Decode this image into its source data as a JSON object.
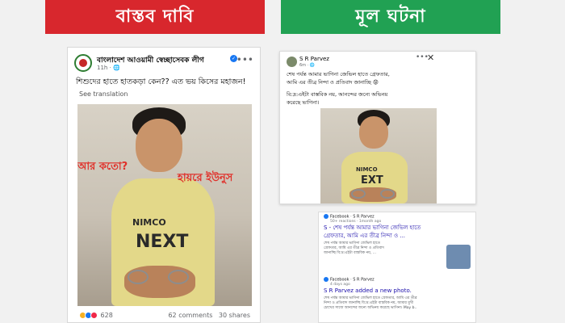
{
  "banners": {
    "left": "বাস্তব দাবি",
    "right": "মূল ঘটনা"
  },
  "left_post": {
    "page_name": "বাংলাদেশ আওয়ামী স্বেচ্ছাসেবক লীগ",
    "verified_icon": "✓",
    "time": "11h · 🌐",
    "more_icon": "•••",
    "text": "শিশুদের হাতে হাতকড়া কেন?? এত ভয় কিসের মহাজন!",
    "translate": "See translation",
    "overlay_1": "আর কতো?",
    "overlay_2": "হায়রে ইউনুস",
    "shirt_text": "NIMCO",
    "shirt_big": "NEXT",
    "reaction_count": "628",
    "comments": "62 comments",
    "shares": "30 shares",
    "colors": {
      "reactions": [
        "#f7b125",
        "#1877f2",
        "#f02849"
      ]
    }
  },
  "right_post": {
    "name": "S R Parvez",
    "time": "6m · 🌐",
    "more_icon": "•••",
    "close_icon": "✕",
    "line1": "শেষ পর্যন্ত আমার ভাগিনা জেভিল হাতে গ্রেফতার,",
    "line2": "আমি এর তীব্র নিন্দা ও প্রতিবাদ জানাচ্ছি 😡",
    "line3": "বি:দ্র:এইটা বাস্তবিক নয়, আনন্দের জন্যে অভিনয়",
    "line4": "করেছে ভাগিনা।",
    "shirt_text": "NIMCO",
    "shirt_big": "EXT"
  },
  "search_results": [
    {
      "source": "Facebook · S R Parvez",
      "sub": "50+ reactions · 1month ago",
      "title": "S - শেষ পর্যন্ত আমার ভাগিনা জেভিল হাতে",
      "title2": "গ্রেফতার, আমি এর তীব্র নিন্দা ও ...",
      "snippet1": "শেষ পর্যন্ত আমার ভাগিনা জেভিল হাতে",
      "snippet2": "গ্রেফতার, আমি এর তীব্র নিন্দা ও প্রতিবাদ",
      "snippet3": "জানাচ্ছি বি:দ্র:এইটা বাস্তবিক নয়, ..."
    },
    {
      "source": "Facebook · S R Parvez",
      "sub": "4 days ago",
      "title": "S R Parvez added a new photo.",
      "snippet1": "শেষ পর্যন্ত আমার ভাগিনা জেভিল হাতে গ্রেফতার, আমি এর তীব্র",
      "snippet2": "নিন্দা ও প্রতিবাদ জানাচ্ছি বি:দ্র:এইটা বাস্তবিক নয়, আমার মুখী",
      "snippet3": "চোখের সাজে আনন্দের জন্যে অভিনয় করেছে ভাগিনা। May b.."
    }
  ]
}
